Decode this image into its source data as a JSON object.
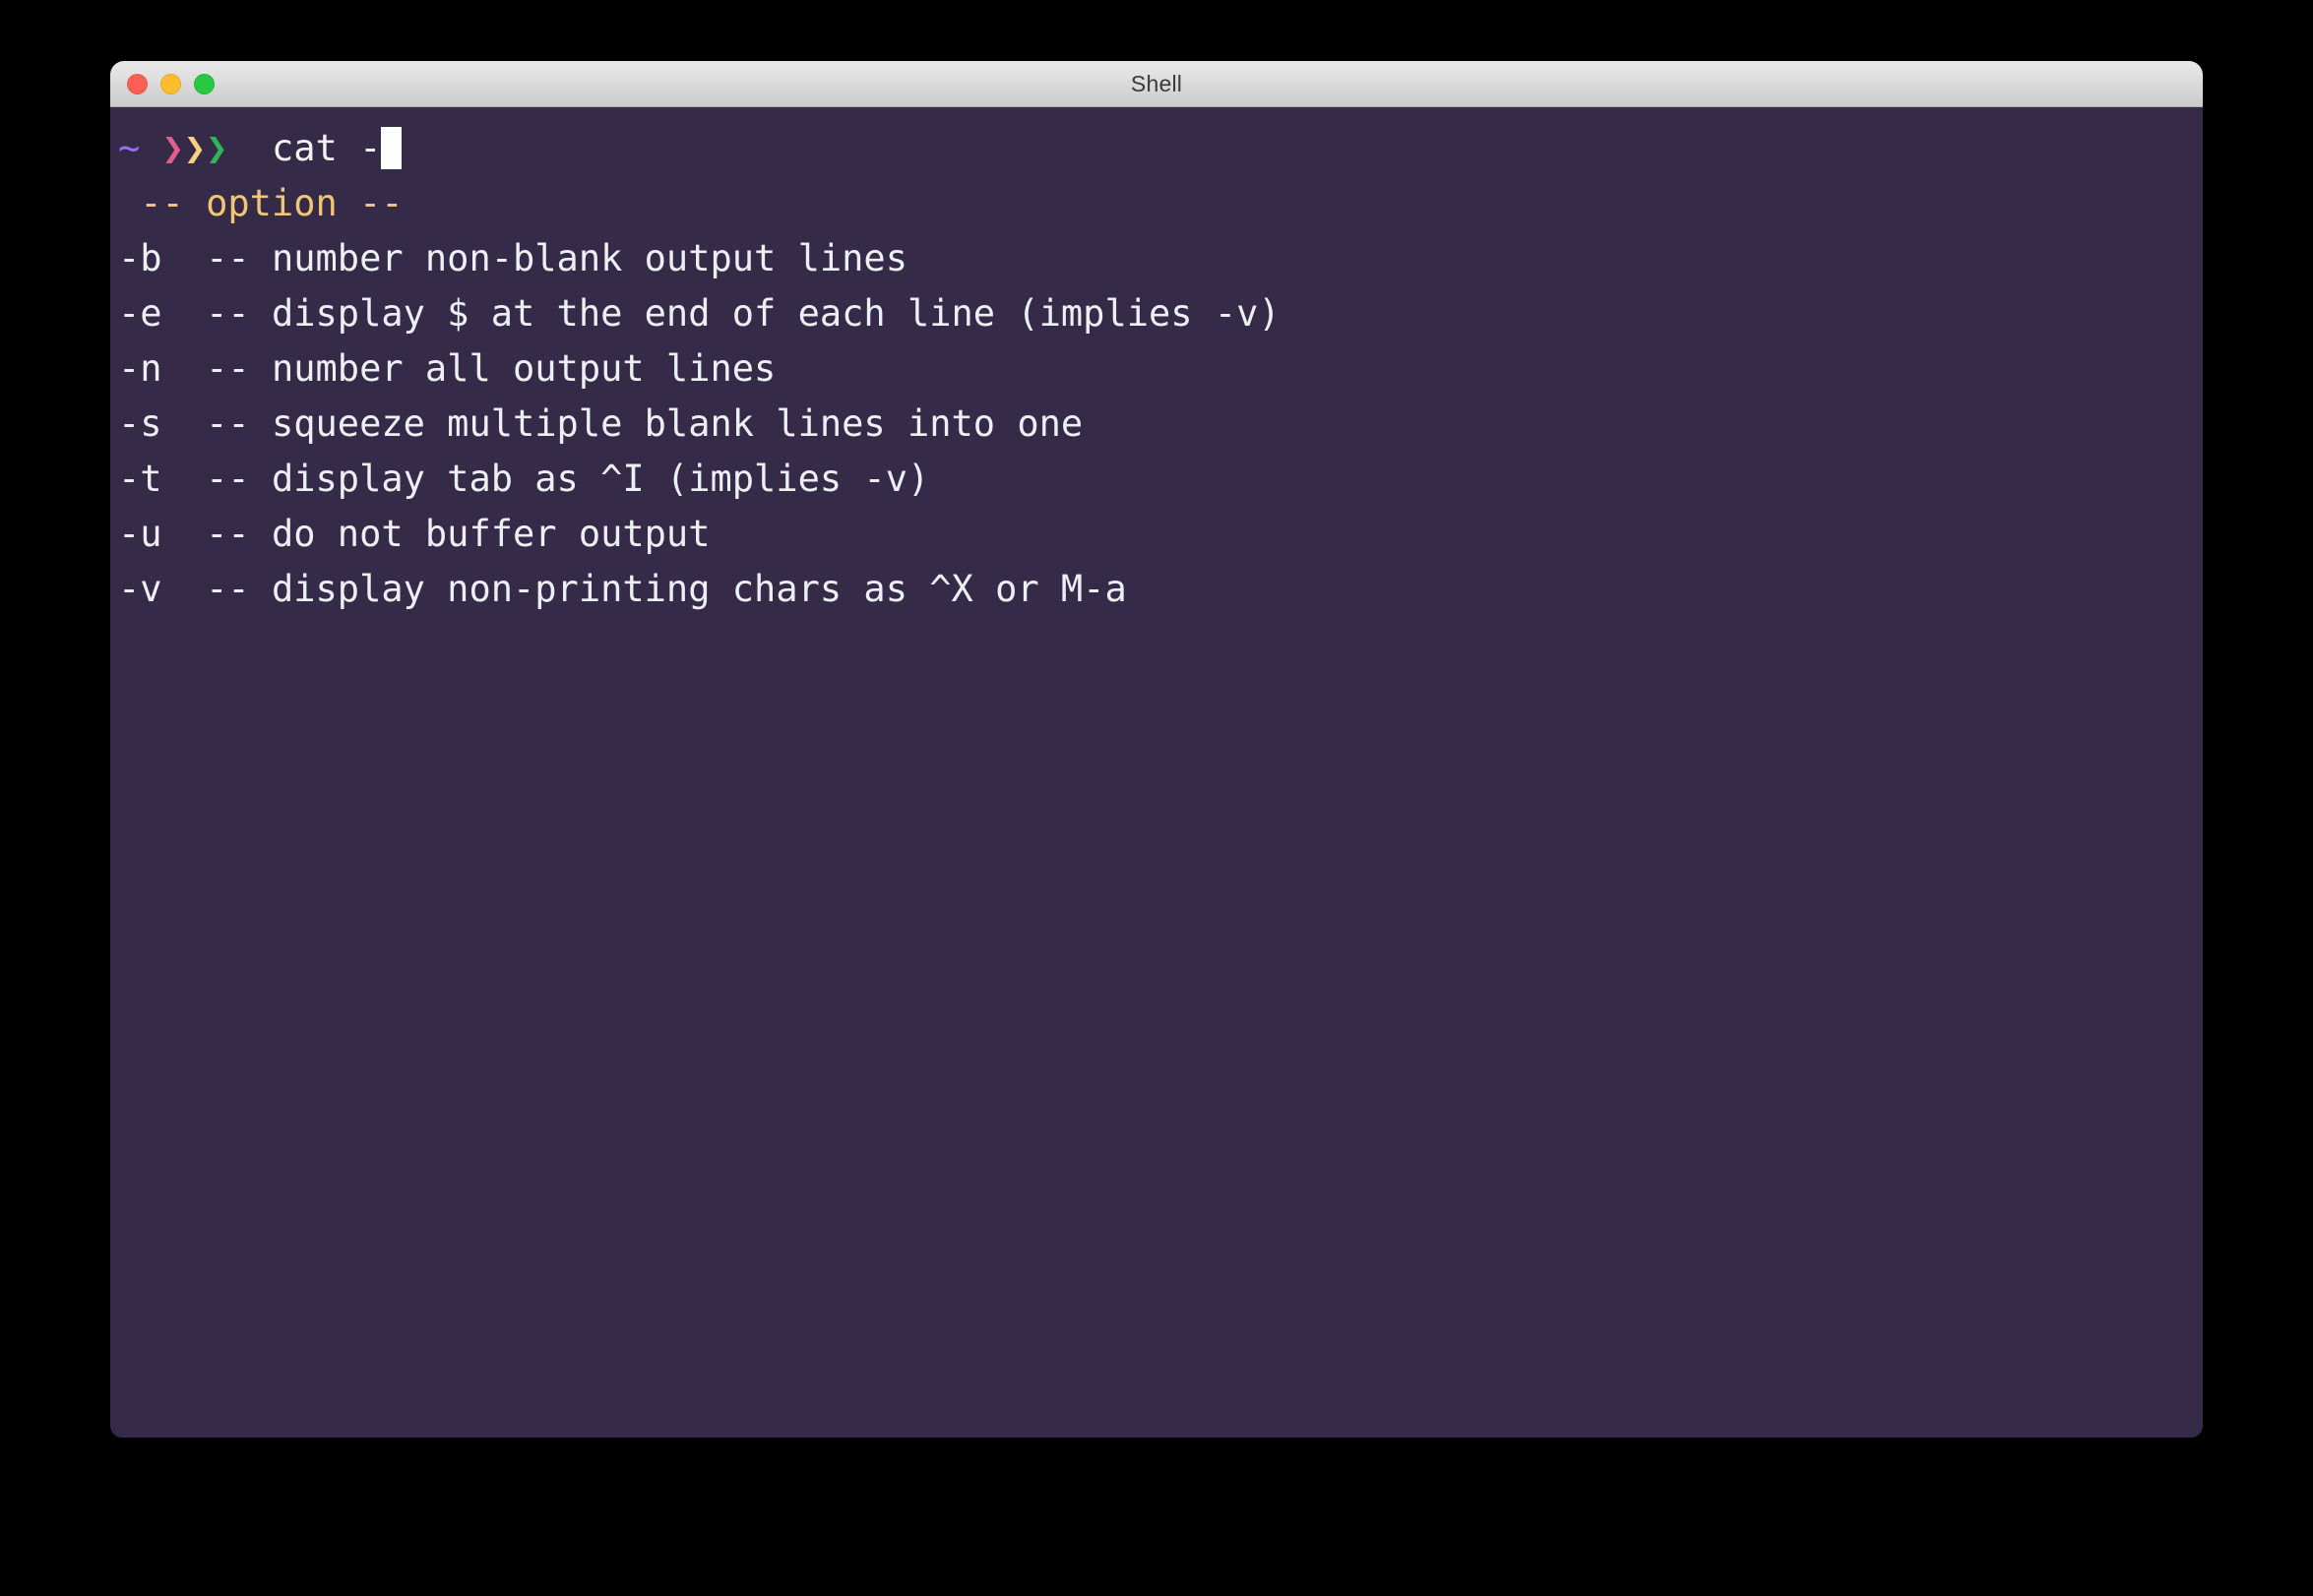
{
  "window": {
    "title": "Shell",
    "controls": [
      {
        "name": "close",
        "label": ""
      },
      {
        "name": "minimize",
        "label": ""
      },
      {
        "name": "zoom",
        "label": ""
      }
    ]
  },
  "colors": {
    "terminal_background": "#352A47",
    "titlebar_top": "#e8e8e8",
    "titlebar_bottom": "#cbcbcb",
    "foreground": "#eceff4",
    "prompt_tilde": "#9b6dff",
    "chevron_1": "#e05f8f",
    "chevron_2": "#fbd07c",
    "chevron_3": "#2fb457",
    "option_header": "#f0c674",
    "cursor": "#ffffff",
    "traffic_close": "#ff5f57",
    "traffic_minimize": "#febc2e",
    "traffic_zoom": "#28c840"
  },
  "prompt": {
    "tilde": "~",
    "chevron_1": "❯",
    "chevron_2": "❯",
    "chevron_3": "❯",
    "command": "cat -"
  },
  "completion": {
    "header": " -- option --",
    "options": [
      {
        "flag": "-b",
        "sep": "--",
        "description": "number non-blank output lines"
      },
      {
        "flag": "-e",
        "sep": "--",
        "description": "display $ at the end of each line (implies -v)"
      },
      {
        "flag": "-n",
        "sep": "--",
        "description": "number all output lines"
      },
      {
        "flag": "-s",
        "sep": "--",
        "description": "squeeze multiple blank lines into one"
      },
      {
        "flag": "-t",
        "sep": "--",
        "description": "display tab as ^I (implies -v)"
      },
      {
        "flag": "-u",
        "sep": "--",
        "description": "do not buffer output"
      },
      {
        "flag": "-v",
        "sep": "--",
        "description": "display non-printing chars as ^X or M-a"
      }
    ]
  }
}
